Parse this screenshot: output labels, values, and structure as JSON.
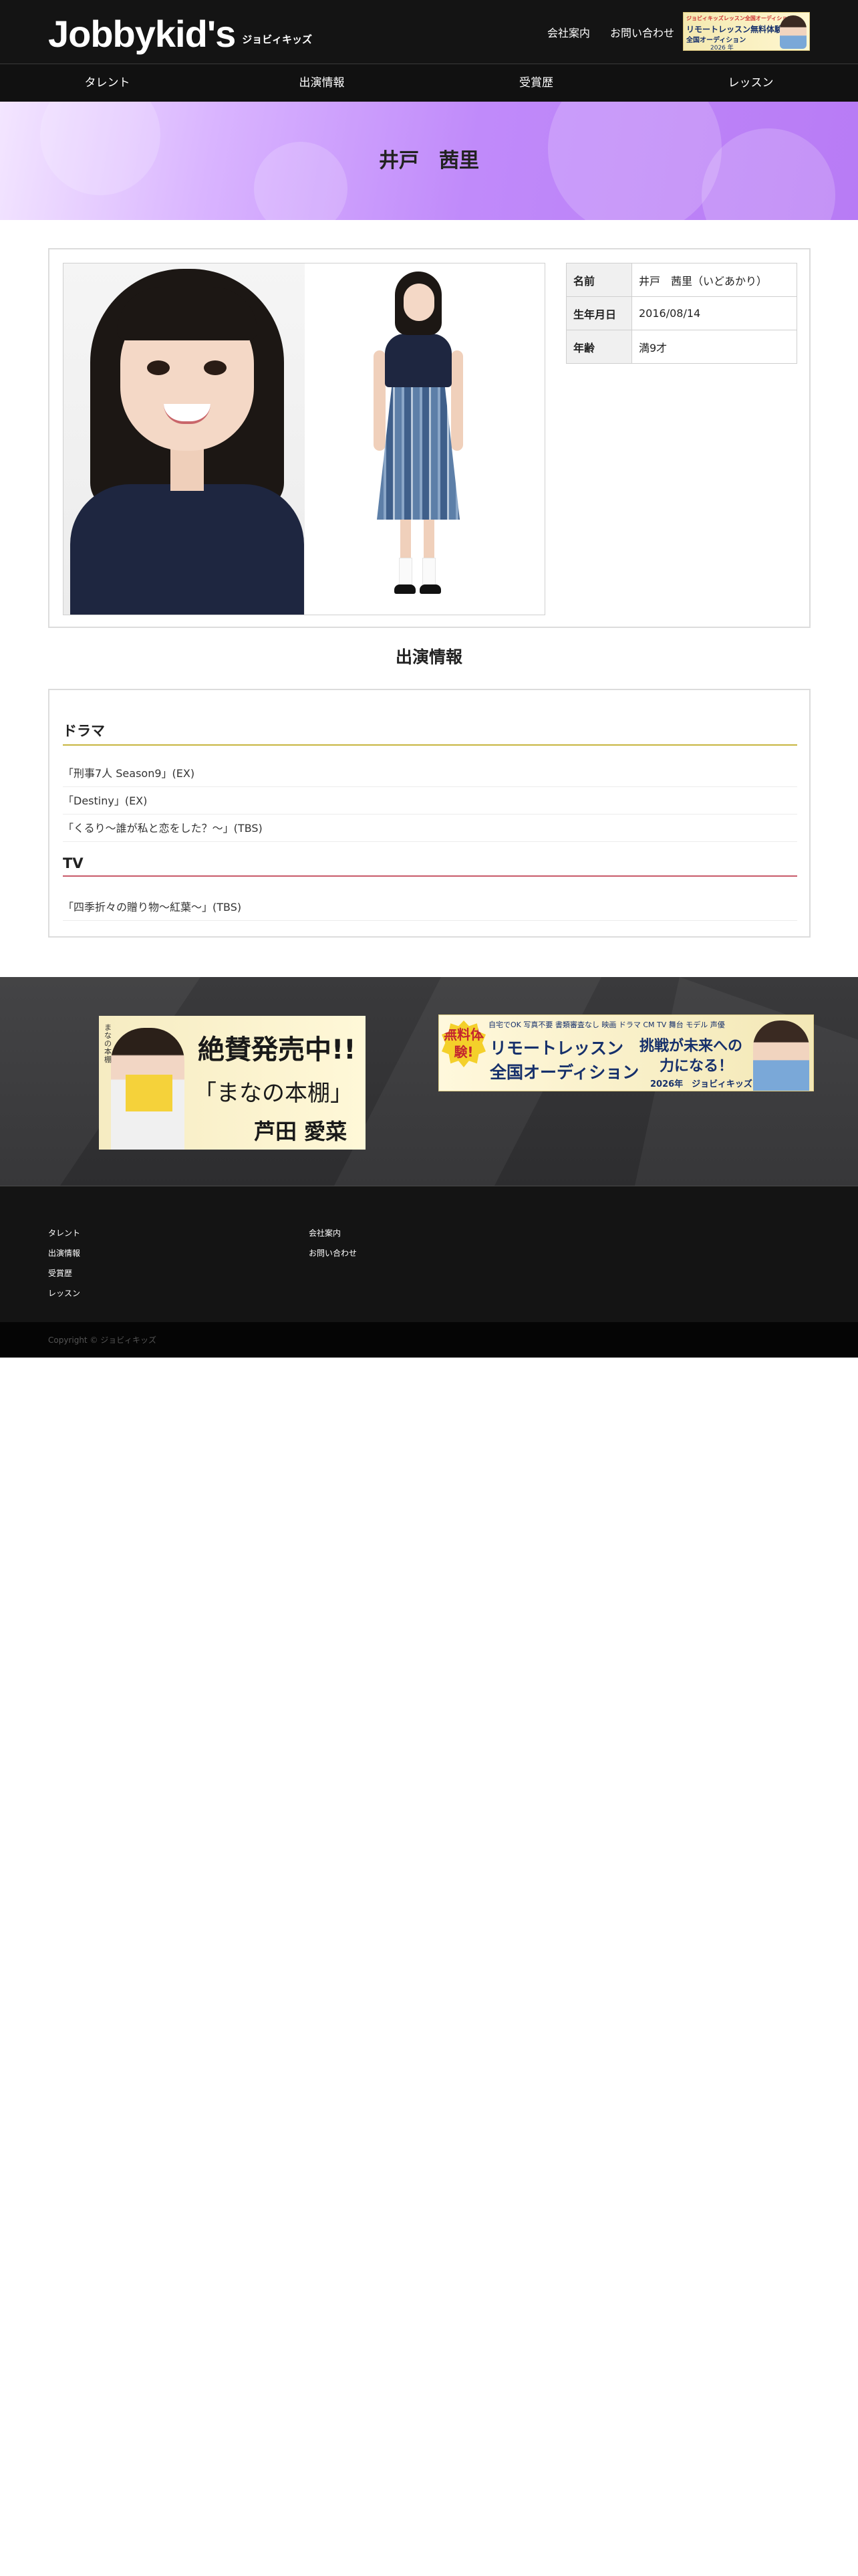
{
  "header": {
    "logo_text": "Jobbykid's",
    "logo_sub": "ジョビィキッズ",
    "links": [
      "会社案内",
      "お問い合わせ"
    ],
    "banner": {
      "line1": "ジョビィキッズレッスン全国オーディション",
      "line2": "リモートレッスン無料体験",
      "line3": "全国オーディション",
      "year": "2026 年"
    }
  },
  "nav": {
    "items": [
      "タレント",
      "出演情報",
      "受賞歴",
      "レッスン"
    ]
  },
  "hero": {
    "title": "井戸　茜里"
  },
  "profile": {
    "rows": [
      {
        "label": "名前",
        "value": "井戸　茜里（いどあかり）"
      },
      {
        "label": "生年月日",
        "value": "2016/08/14"
      },
      {
        "label": "年齢",
        "value": "満9才"
      }
    ]
  },
  "appearances": {
    "title": "出演情報",
    "categories": [
      {
        "name": "ドラマ",
        "items": [
          "「刑事7人 Season9」(EX)",
          "「Destiny」(EX)",
          "「くるり〜誰が私と恋をした？〜」(TBS)"
        ]
      },
      {
        "name": "TV",
        "items": [
          "「四季折々の贈り物〜紅葉〜」(TBS)"
        ]
      }
    ]
  },
  "footer_banners": {
    "book": {
      "side": "まなの本棚",
      "title": "絶賛発売中!!",
      "subtitle": "「まなの本棚」",
      "author": "芦田 愛菜"
    },
    "lesson": {
      "badge": "無料体験!",
      "tags": "自宅でOK  写真不要  書類審査なし  映画 ドラマ CM TV 舞台 モデル 声優",
      "main1": "リモートレッスン",
      "main2": "全国オーディション",
      "challenge1": "挑戦が未来への",
      "challenge2": "力になる！",
      "year": "2026年　ジョビィキッズ"
    }
  },
  "footer": {
    "col1": [
      "タレント",
      "出演情報",
      "受賞歴",
      "レッスン"
    ],
    "col2": [
      "会社案内",
      "お問い合わせ"
    ],
    "copyright": "Copyright © ジョビィキッズ"
  }
}
